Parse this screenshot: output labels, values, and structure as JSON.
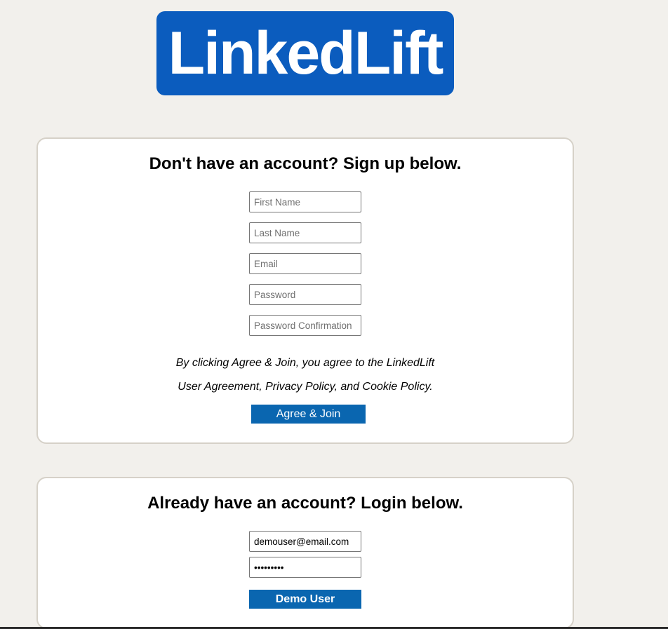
{
  "logo": {
    "text": "LinkedLift",
    "color": "#0b5cbe"
  },
  "signup": {
    "heading": "Don't have an account? Sign up below.",
    "fields": {
      "first_name": {
        "placeholder": "First Name",
        "value": ""
      },
      "last_name": {
        "placeholder": "Last Name",
        "value": ""
      },
      "email": {
        "placeholder": "Email",
        "value": ""
      },
      "password": {
        "placeholder": "Password",
        "value": ""
      },
      "password_confirmation": {
        "placeholder": "Password Confirmation",
        "value": ""
      }
    },
    "agreement_line1": "By clicking Agree & Join, you agree to the LinkedLift",
    "agreement_line2": "User Agreement, Privacy Policy, and Cookie Policy.",
    "submit_label": "Agree & Join"
  },
  "login": {
    "heading": "Already have an account? Login below.",
    "email_value": "demouser@email.com",
    "password_value": "password1",
    "submit_label": "Demo User"
  },
  "colors": {
    "background": "#f2f0ec",
    "button": "#0a66b0",
    "card_border": "#d6d1c8"
  }
}
